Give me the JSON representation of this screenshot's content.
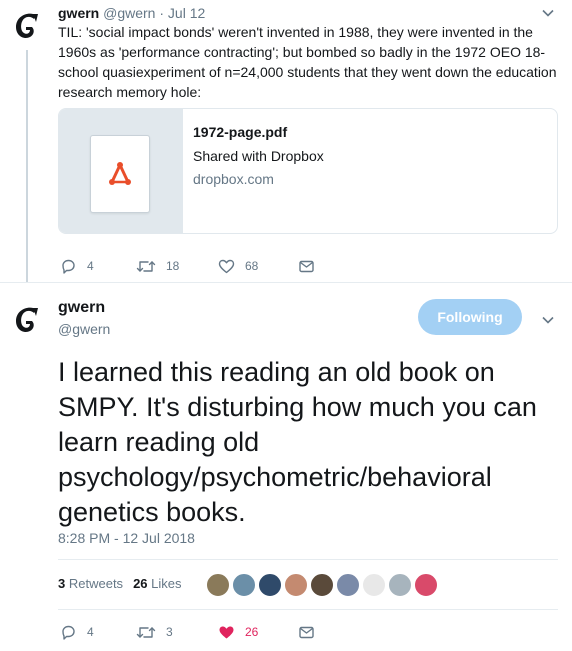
{
  "parent_tweet": {
    "name": "gwern",
    "handle": "@gwern",
    "separator": "·",
    "time": "Jul 12",
    "text": "TIL: 'social impact bonds' weren't invented in 1988, they were invented  in the 1960s as 'performance contracting'; but bombed so badly in the  1972 OEO 18-school quasiexperiment of n=24,000 students that they went  down the education research memory hole:",
    "link_card": {
      "title": "1972-page.pdf",
      "description": "Shared with Dropbox",
      "domain": "dropbox.com",
      "icon": "pdf-icon"
    },
    "actions": {
      "replies": "4",
      "retweets": "18",
      "likes": "68"
    }
  },
  "focus_tweet": {
    "name": "gwern",
    "handle": "@gwern",
    "follow_label": "Following",
    "text": "I learned this reading an old book on SMPY. It's disturbing how much you can learn reading old psychology/psychometric/behavioral genetics books.",
    "timestamp": "8:28 PM - 12 Jul 2018",
    "stats": {
      "retweets_count": "3",
      "retweets_label": "Retweets",
      "likes_count": "26",
      "likes_label": "Likes"
    },
    "likers_avatar_colors": [
      "#8a7a5a",
      "#6b8fa8",
      "#2f4a6a",
      "#c48a70",
      "#5a4a3a",
      "#7a8aa8",
      "#e8e8e8",
      "#a7b4bd",
      "#d94a6a"
    ],
    "actions": {
      "replies": "4",
      "retweets": "3",
      "likes": "26"
    }
  },
  "colors": {
    "follow_button": "#a3d0f4",
    "like_active": "#e0245e",
    "pdf_icon": "#e94e2b",
    "secondary_text": "#657786"
  }
}
